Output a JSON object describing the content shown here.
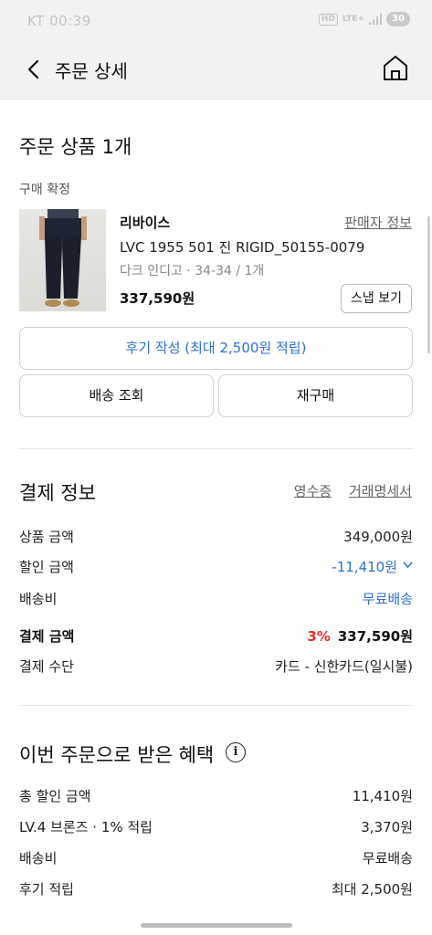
{
  "status_bar": {
    "carrier": "KT",
    "time": "00:39",
    "hd": "HD",
    "network": "LTE+",
    "battery": "30"
  },
  "header": {
    "title": "주문 상세",
    "back_icon": "chevron-left-icon",
    "home_icon": "home-icon"
  },
  "order_items": {
    "title": "주문 상품 1개",
    "status": "구매 확정",
    "product": {
      "brand": "리바이스",
      "seller_link": "판매자 정보",
      "name": "LVC 1955 501 진 RIGID_50155-0079",
      "option": "다크 인디고 · 34-34 / 1개",
      "price": "337,590원",
      "snap_button": "스냅 보기"
    },
    "review_button": "후기 작성 (최대 2,500원 적립)",
    "shipping_button": "배송 조회",
    "rebuy_button": "재구매"
  },
  "payment": {
    "title": "결제 정보",
    "receipt_link": "영수증",
    "statement_link": "거래명세서",
    "rows": [
      {
        "label": "상품 금액",
        "value": "349,000원"
      },
      {
        "label": "할인 금액",
        "value": "-11,410원"
      },
      {
        "label": "배송비",
        "value": "무료배송"
      },
      {
        "label": "결제 금액",
        "value": "337,590원",
        "rate": "3%"
      },
      {
        "label": "결제 수단",
        "value": "카드 - 신한카드(일시불)"
      }
    ]
  },
  "benefits": {
    "title": "이번 주문으로 받은 혜택",
    "info_icon": "info-icon",
    "rows": [
      {
        "label": "총 할인 금액",
        "value": "11,410원"
      },
      {
        "label": "LV.4 브론즈 · 1% 적립",
        "value": "3,370원"
      },
      {
        "label": "배송비",
        "value": "무료배송"
      },
      {
        "label": "후기 적립",
        "value": "최대 2,500원"
      }
    ]
  },
  "colors": {
    "accent_blue": "#2f6fd8",
    "discount_red": "#e0302d",
    "background": "#f2f2f2"
  }
}
